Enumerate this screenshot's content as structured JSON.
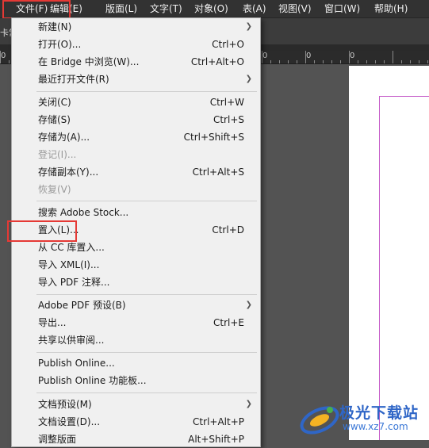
{
  "menubar": {
    "items": [
      "文件(F)",
      "编辑(E)",
      "版面(L)",
      "文字(T)",
      "对象(O)",
      "表(A)",
      "视图(V)",
      "窗口(W)",
      "帮助(H)"
    ]
  },
  "control_strip": {
    "label": "卡常"
  },
  "ruler": {
    "numbers": [
      "0",
      "0",
      "0",
      "0",
      "0",
      "0",
      "0",
      "0",
      "0"
    ]
  },
  "file_menu": {
    "new": {
      "label": "新建(N)"
    },
    "open": {
      "label": "打开(O)...",
      "shortcut": "Ctrl+O"
    },
    "bridge": {
      "label": "在 Bridge 中浏览(W)...",
      "shortcut": "Ctrl+Alt+O"
    },
    "recent": {
      "label": "最近打开文件(R)"
    },
    "close": {
      "label": "关闭(C)",
      "shortcut": "Ctrl+W"
    },
    "save": {
      "label": "存储(S)",
      "shortcut": "Ctrl+S"
    },
    "save_as": {
      "label": "存储为(A)...",
      "shortcut": "Ctrl+Shift+S"
    },
    "check_in": {
      "label": "登记(I)..."
    },
    "save_copy": {
      "label": "存储副本(Y)...",
      "shortcut": "Ctrl+Alt+S"
    },
    "revert": {
      "label": "恢复(V)"
    },
    "search_stock": {
      "label": "搜索 Adobe Stock..."
    },
    "place": {
      "label": "置入(L)...",
      "shortcut": "Ctrl+D"
    },
    "place_cc": {
      "label": "从 CC 库置入..."
    },
    "import_xml": {
      "label": "导入 XML(I)..."
    },
    "import_pdf": {
      "label": "导入 PDF 注释..."
    },
    "pdf_presets": {
      "label": "Adobe PDF 预设(B)"
    },
    "export": {
      "label": "导出...",
      "shortcut": "Ctrl+E"
    },
    "share_review": {
      "label": "共享以供审阅..."
    },
    "publish_online": {
      "label": "Publish Online..."
    },
    "publish_dashboard": {
      "label": "Publish Online 功能板..."
    },
    "doc_presets": {
      "label": "文档预设(M)"
    },
    "doc_setup": {
      "label": "文档设置(D)...",
      "shortcut": "Ctrl+Alt+P"
    },
    "adjust_layout": {
      "label": "调整版面",
      "shortcut": "Alt+Shift+P"
    }
  },
  "watermark": {
    "title": "极光下载站",
    "url": "www.xz7.com"
  },
  "colors": {
    "highlight": "#e53935",
    "menu_bg": "#f0f0f0",
    "app_bg": "#535353",
    "watermark": "#2f66c7"
  }
}
